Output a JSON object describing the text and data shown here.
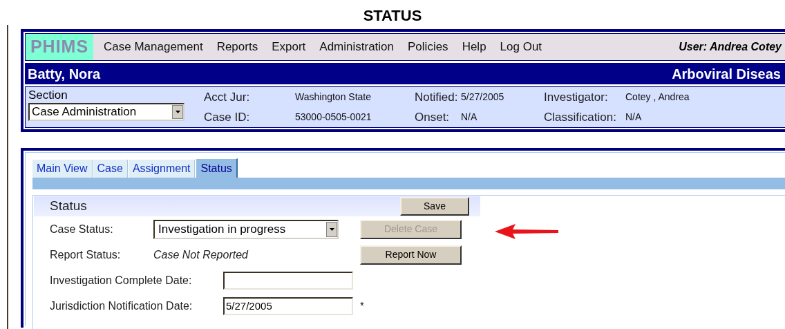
{
  "page_title": "STATUS",
  "logo": "PHIMS",
  "menu": [
    "Case Management",
    "Reports",
    "Export",
    "Administration",
    "Policies",
    "Help",
    "Log Out"
  ],
  "user": "User: Andrea Cotey",
  "patient_name": "Batty, Nora",
  "condition": "Arboviral Diseas",
  "section": {
    "label": "Section",
    "value": "Case Administration"
  },
  "summary": [
    {
      "label": "Acct Jur:",
      "value": "Washington State"
    },
    {
      "label": "Notified:",
      "value": "5/27/2005"
    },
    {
      "label": "Investigator:",
      "value": "Cotey , Andrea"
    },
    {
      "label": "Case ID:",
      "value": "53000-0505-0021"
    },
    {
      "label": "Onset:",
      "value": "N/A"
    },
    {
      "label": "Classification:",
      "value": "N/A"
    }
  ],
  "tabs": [
    {
      "label": "Main View",
      "selected": false
    },
    {
      "label": "Case",
      "selected": false
    },
    {
      "label": "Assignment",
      "selected": false
    },
    {
      "label": "Status",
      "selected": true
    }
  ],
  "panel": {
    "title": "Status",
    "save_button": "Save"
  },
  "rows": [
    {
      "kind": "select",
      "label": "Case Status:",
      "value": "Investigation in progress",
      "button": {
        "label": "Delete Case",
        "disabled": true
      },
      "callout": true
    },
    {
      "kind": "text",
      "label": "Report Status:",
      "value": "Case Not Reported",
      "button": {
        "label": "Report Now",
        "disabled": false
      }
    },
    {
      "kind": "input",
      "label": "Investigation Complete Date:",
      "value": ""
    },
    {
      "kind": "input",
      "label": "Jurisdiction Notification Date:",
      "value": "5/27/2005",
      "required_mark": "*"
    }
  ]
}
